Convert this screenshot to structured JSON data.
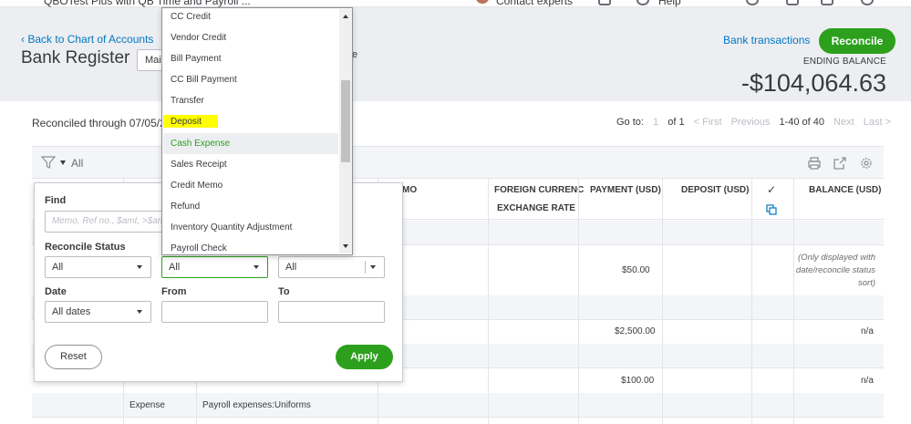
{
  "topbar": {
    "company": "QBOTest Plus with QB Time and Payroll ...",
    "contact": "Contact experts",
    "help": "Help"
  },
  "header": {
    "back_link": "Back to Chart of Accounts",
    "title": "Bank Register",
    "account_value": "Main",
    "trailing_fragment": "e",
    "bank_transactions": "Bank transactions",
    "reconcile": "Reconcile",
    "ending_balance_label": "ENDING BALANCE",
    "ending_balance_value": "-$104,064.63"
  },
  "recon_through": "Reconciled through 07/05/2",
  "pager": {
    "goto": "Go to:",
    "page": "1",
    "of": "of 1",
    "first": "< First",
    "previous": "Previous",
    "range": "1-40 of 40",
    "next": "Next",
    "last": "Last >"
  },
  "filterbar": {
    "label": "All"
  },
  "columns": {
    "memo": "MO",
    "foreign_currency": "FOREIGN CURRENC",
    "exchange_rate": "EXCHANGE RATE",
    "payment": "PAYMENT (USD)",
    "deposit": "DEPOSIT (USD)",
    "check": "✓",
    "balance": "BALANCE (USD)"
  },
  "rows": [
    {
      "payment": "$50.00",
      "balance_note": "(Only displayed with date/reconcile status sort)"
    },
    {
      "payment": "$2,500.00",
      "balance": "n/a"
    },
    {
      "payment": "$100.00",
      "balance": "n/a",
      "type": "Expense",
      "account": "Payroll expenses:Uniforms"
    }
  ],
  "filter_popup": {
    "find_label": "Find",
    "find_placeholder": "Memo, Ref no., $amt, >$amt",
    "reconcile_status_label": "Reconcile Status",
    "reconcile_status_value": "All",
    "transaction_type_value": "All",
    "payee_value": "All",
    "date_label": "Date",
    "date_value": "All dates",
    "from_label": "From",
    "to_label": "To",
    "reset": "Reset",
    "apply": "Apply"
  },
  "type_options": [
    "CC Credit",
    "Vendor Credit",
    "Bill Payment",
    "CC Bill Payment",
    "Transfer",
    "Deposit",
    "Cash Expense",
    "Sales Receipt",
    "Credit Memo",
    "Refund",
    "Inventory Quantity Adjustment",
    "Payroll Check"
  ],
  "colors": {
    "green": "#2ca01c",
    "blue_link": "#0077c5",
    "text": "#393a3d",
    "highlight": "#ffff00",
    "header_bg": "#eceef1"
  }
}
